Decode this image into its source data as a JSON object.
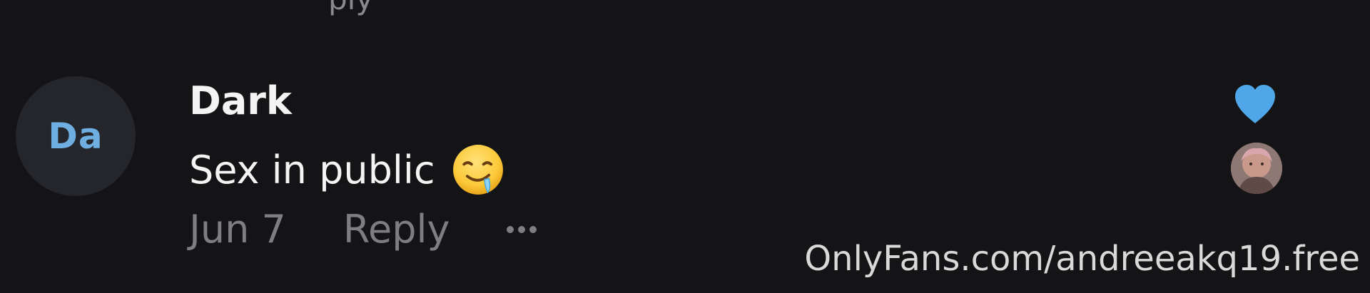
{
  "previous_comment": {
    "partial_text": "ply"
  },
  "comment": {
    "avatar_initials": "Da",
    "author": "Dark",
    "text": "Sex in public",
    "emoji": "drooling-face-emoji",
    "date": "Jun 7",
    "reply_label": "Reply",
    "liked": true
  },
  "watermark": "OnlyFans.com/andreeakq19.free",
  "colors": {
    "background": "#141416",
    "accent": "#4fa6e8",
    "initials": "#6faee0",
    "muted_text": "#7d7d82"
  },
  "icons": {
    "like": "heart-icon",
    "more": "more-options-icon"
  }
}
